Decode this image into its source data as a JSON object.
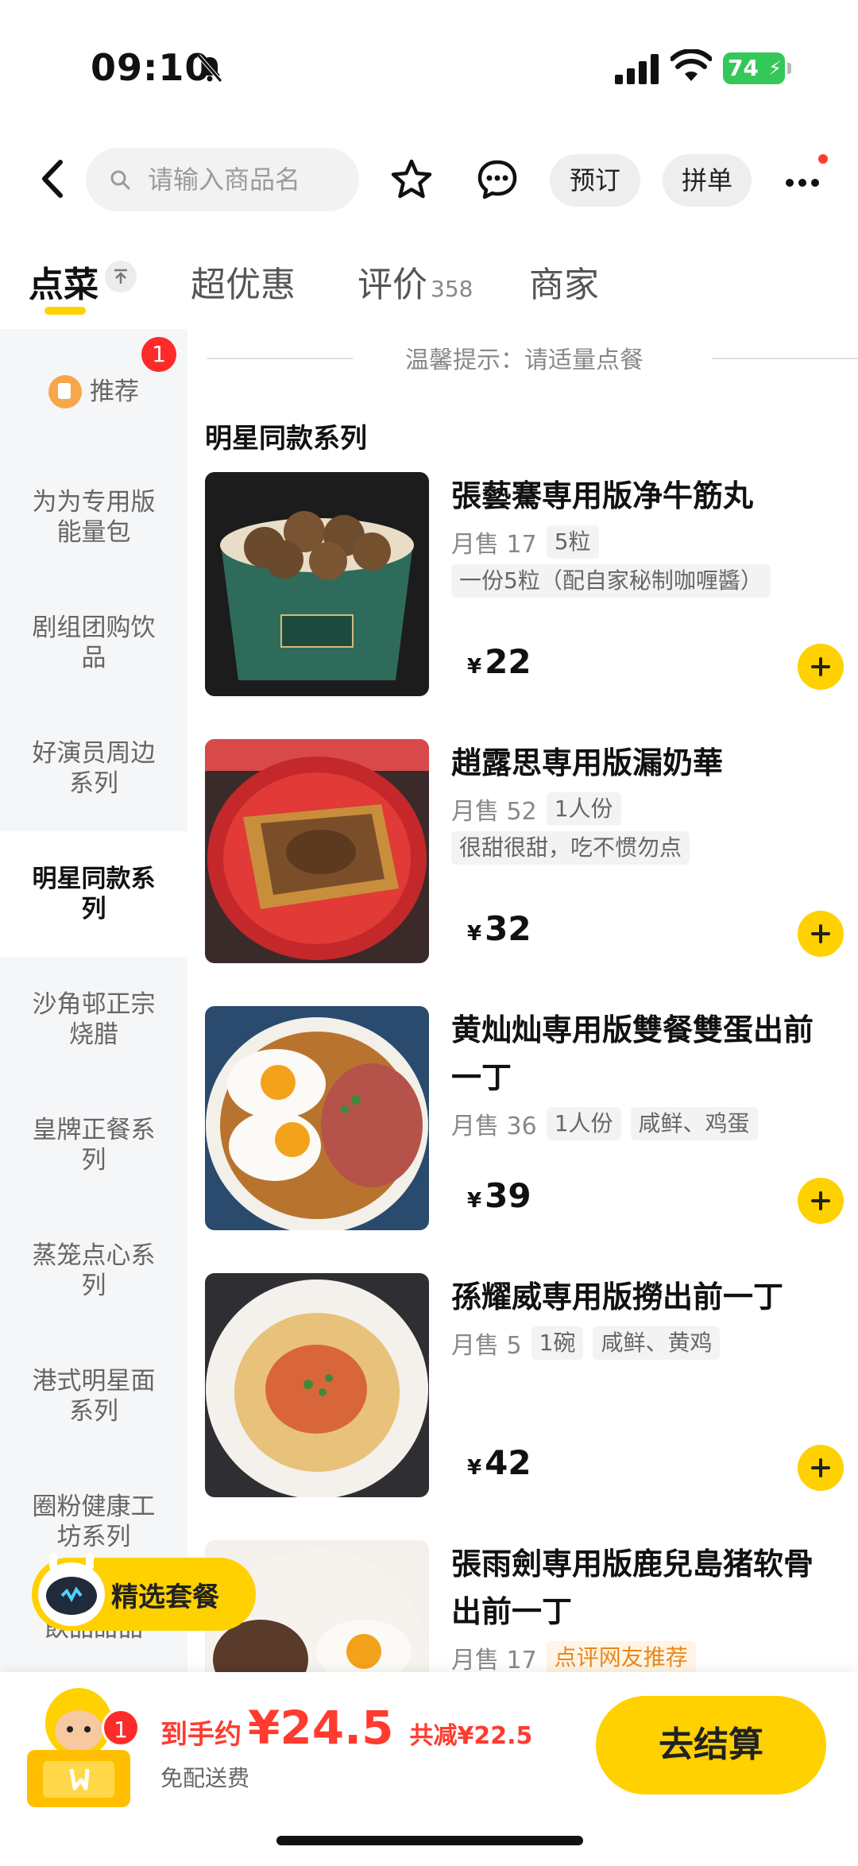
{
  "status": {
    "time": "09:10",
    "battery": "74"
  },
  "nav": {
    "search_placeholder": "请输入商品名",
    "reserve": "预订",
    "group_buy": "拼单"
  },
  "tabs": [
    {
      "label": "点菜"
    },
    {
      "label": "超优惠"
    },
    {
      "label": "评价",
      "count": "358"
    },
    {
      "label": "商家"
    }
  ],
  "sidebar": {
    "recommend": {
      "label": "推荐",
      "badge": "1"
    },
    "items": [
      {
        "label": "为为专用版能量包"
      },
      {
        "label": "剧组团购饮品"
      },
      {
        "label": "好演员周边系列"
      },
      {
        "label": "明星同款系列"
      },
      {
        "label": "沙角邨正宗烧腊"
      },
      {
        "label": "皇牌正餐系列"
      },
      {
        "label": "蒸笼点心系列"
      },
      {
        "label": "港式明星面系列"
      },
      {
        "label": "圈粉健康工坊系列"
      },
      {
        "label": "飲品甜品"
      }
    ]
  },
  "main": {
    "tip": "温馨提示：请适量点餐",
    "section_title": "明星同款系列",
    "items": [
      {
        "name": "張藝騫専用版净牛筋丸",
        "sales": "月售 17",
        "tags": [
          "5粒"
        ],
        "desc": "一份5粒（配自家秘制咖喱醬）",
        "currency": "¥",
        "price": "22"
      },
      {
        "name": "趙露思専用版漏奶華",
        "sales": "月售 52",
        "tags": [
          "1人份"
        ],
        "desc": "很甜很甜，吃不惯勿点",
        "currency": "¥",
        "price": "32"
      },
      {
        "name": "黄灿灿専用版雙餐雙蛋出前一丁",
        "sales": "月售 36",
        "tags": [
          "1人份",
          "咸鲜、鸡蛋"
        ],
        "currency": "¥",
        "price": "39"
      },
      {
        "name": "孫耀威専用版撈出前一丁",
        "sales": "月售 5",
        "tags": [
          "1碗",
          "咸鲜、黄鸡"
        ],
        "currency": "¥",
        "price": "42"
      },
      {
        "name": "張雨劍専用版鹿兒島猪软骨出前一丁",
        "sales": "月售 17",
        "tags": [
          "点评网友推荐"
        ]
      }
    ]
  },
  "combo": {
    "label": "精选套餐"
  },
  "cart": {
    "badge": "1",
    "pay_label": "到手约",
    "pay_amount": "¥24.5",
    "savings": "共减¥22.5",
    "delivery": "免配送费",
    "checkout": "去结算"
  },
  "colors": {
    "accent": "#ffd100",
    "price_red": "#ff3b30"
  }
}
